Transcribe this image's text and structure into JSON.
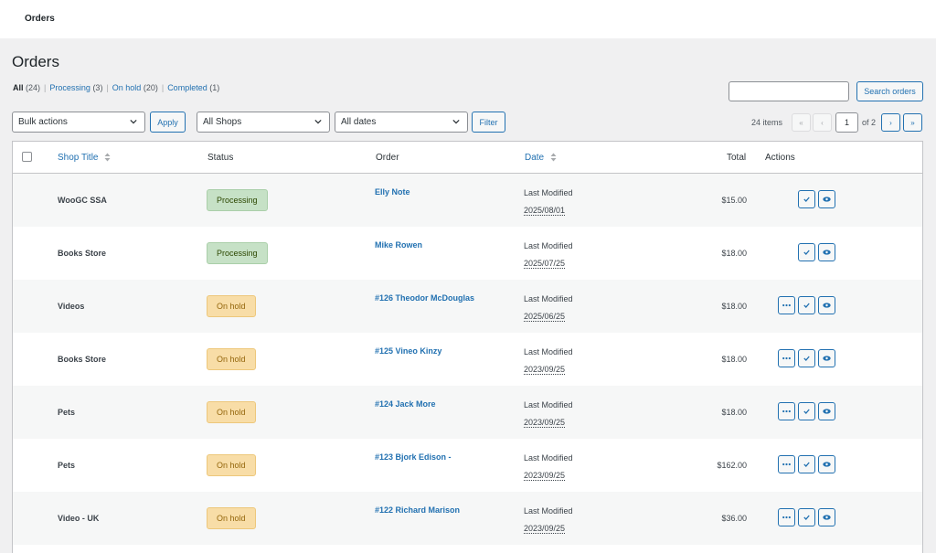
{
  "topbar": {
    "title": "Orders"
  },
  "page": {
    "title": "Orders"
  },
  "filters_nav": [
    {
      "label": "All",
      "count": "(24)",
      "current": true
    },
    {
      "label": "Processing",
      "count": "(3)",
      "current": false
    },
    {
      "label": "On hold",
      "count": "(20)",
      "current": false
    },
    {
      "label": "Completed",
      "count": "(1)",
      "current": false
    }
  ],
  "search": {
    "placeholder": "",
    "button_label": "Search orders"
  },
  "bulk": {
    "selected": "Bulk actions",
    "apply_label": "Apply"
  },
  "shops_filter": {
    "selected": "All Shops"
  },
  "dates_filter": {
    "selected": "All dates"
  },
  "filter_button": "Filter",
  "pagination": {
    "items_label": "24 items",
    "current_page": "1",
    "of_label": "of 2",
    "first": "«",
    "prev": "‹",
    "next": "›",
    "last": "»"
  },
  "table": {
    "columns": {
      "shop_title": "Shop Title",
      "status": "Status",
      "order": "Order",
      "date": "Date",
      "total": "Total",
      "actions": "Actions"
    },
    "rows": [
      {
        "shop": "WooGC SSA",
        "status": "Processing",
        "order": "Elly Note",
        "date_label": "Last Modified",
        "date": "2025/08/01",
        "total": "$15.00",
        "actions": [
          "complete",
          "view"
        ]
      },
      {
        "shop": "Books Store",
        "status": "Processing",
        "order": "Mike Rowen",
        "date_label": "Last Modified",
        "date": "2025/07/25",
        "total": "$18.00",
        "actions": [
          "complete",
          "view"
        ]
      },
      {
        "shop": "Videos",
        "status": "On hold",
        "order": "#126 Theodor McDouglas",
        "date_label": "Last Modified",
        "date": "2025/06/25",
        "total": "$18.00",
        "actions": [
          "processing",
          "complete",
          "view"
        ]
      },
      {
        "shop": "Books Store",
        "status": "On hold",
        "order": "#125 Vineo Kinzy",
        "date_label": "Last Modified",
        "date": "2023/09/25",
        "total": "$18.00",
        "actions": [
          "processing",
          "complete",
          "view"
        ]
      },
      {
        "shop": "Pets",
        "status": "On hold",
        "order": "#124 Jack More",
        "date_label": "Last Modified",
        "date": "2023/09/25",
        "total": "$18.00",
        "actions": [
          "processing",
          "complete",
          "view"
        ]
      },
      {
        "shop": "Pets",
        "status": "On hold",
        "order": "#123 Bjork Edison -",
        "date_label": "Last Modified",
        "date": "2023/09/25",
        "total": "$162.00",
        "actions": [
          "processing",
          "complete",
          "view"
        ]
      },
      {
        "shop": "Video - UK",
        "status": "On hold",
        "order": "#122 Richard Marison",
        "date_label": "Last Modified",
        "date": "2023/09/25",
        "total": "$36.00",
        "actions": [
          "processing",
          "complete",
          "view"
        ]
      }
    ]
  },
  "colors": {
    "accent": "#2271b1",
    "processing_bg": "#c6e1c6",
    "onhold_bg": "#f8dda7"
  }
}
